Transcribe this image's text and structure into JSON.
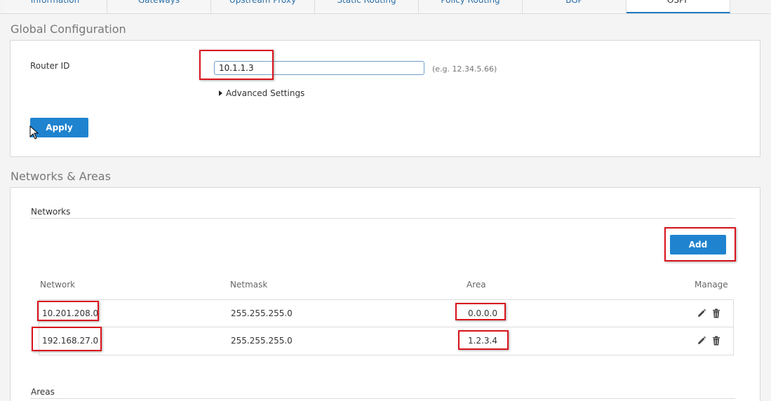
{
  "tabs": [
    {
      "label": "Information",
      "active": false
    },
    {
      "label": "Gateways",
      "active": false
    },
    {
      "label": "Upstream Proxy",
      "active": false
    },
    {
      "label": "Static Routing",
      "active": false
    },
    {
      "label": "Policy Routing",
      "active": false
    },
    {
      "label": "BGP",
      "active": false
    },
    {
      "label": "OSPF",
      "active": true
    }
  ],
  "global": {
    "section_title": "Global Configuration",
    "router_id_label": "Router ID",
    "router_id_value": "10.1.1.3",
    "router_id_hint": "(e.g. 12.34.5.66)",
    "advanced_label": "Advanced Settings",
    "apply_label": "Apply"
  },
  "networks_areas": {
    "section_title": "Networks & Areas",
    "networks_heading": "Networks",
    "add_label": "Add",
    "columns": [
      "Network",
      "Netmask",
      "Area",
      "Manage"
    ],
    "rows": [
      {
        "network": "10.201.208.0",
        "netmask": "255.255.255.0",
        "area": "0.0.0.0"
      },
      {
        "network": "192.168.27.0",
        "netmask": "255.255.255.0",
        "area": "1.2.3.4"
      }
    ],
    "areas_heading": "Areas"
  },
  "colors": {
    "accent": "#1f83cf",
    "highlight": "#d9131c"
  },
  "icons": [
    "edit-icon",
    "trash-icon",
    "caret-right-icon",
    "cursor-icon"
  ]
}
